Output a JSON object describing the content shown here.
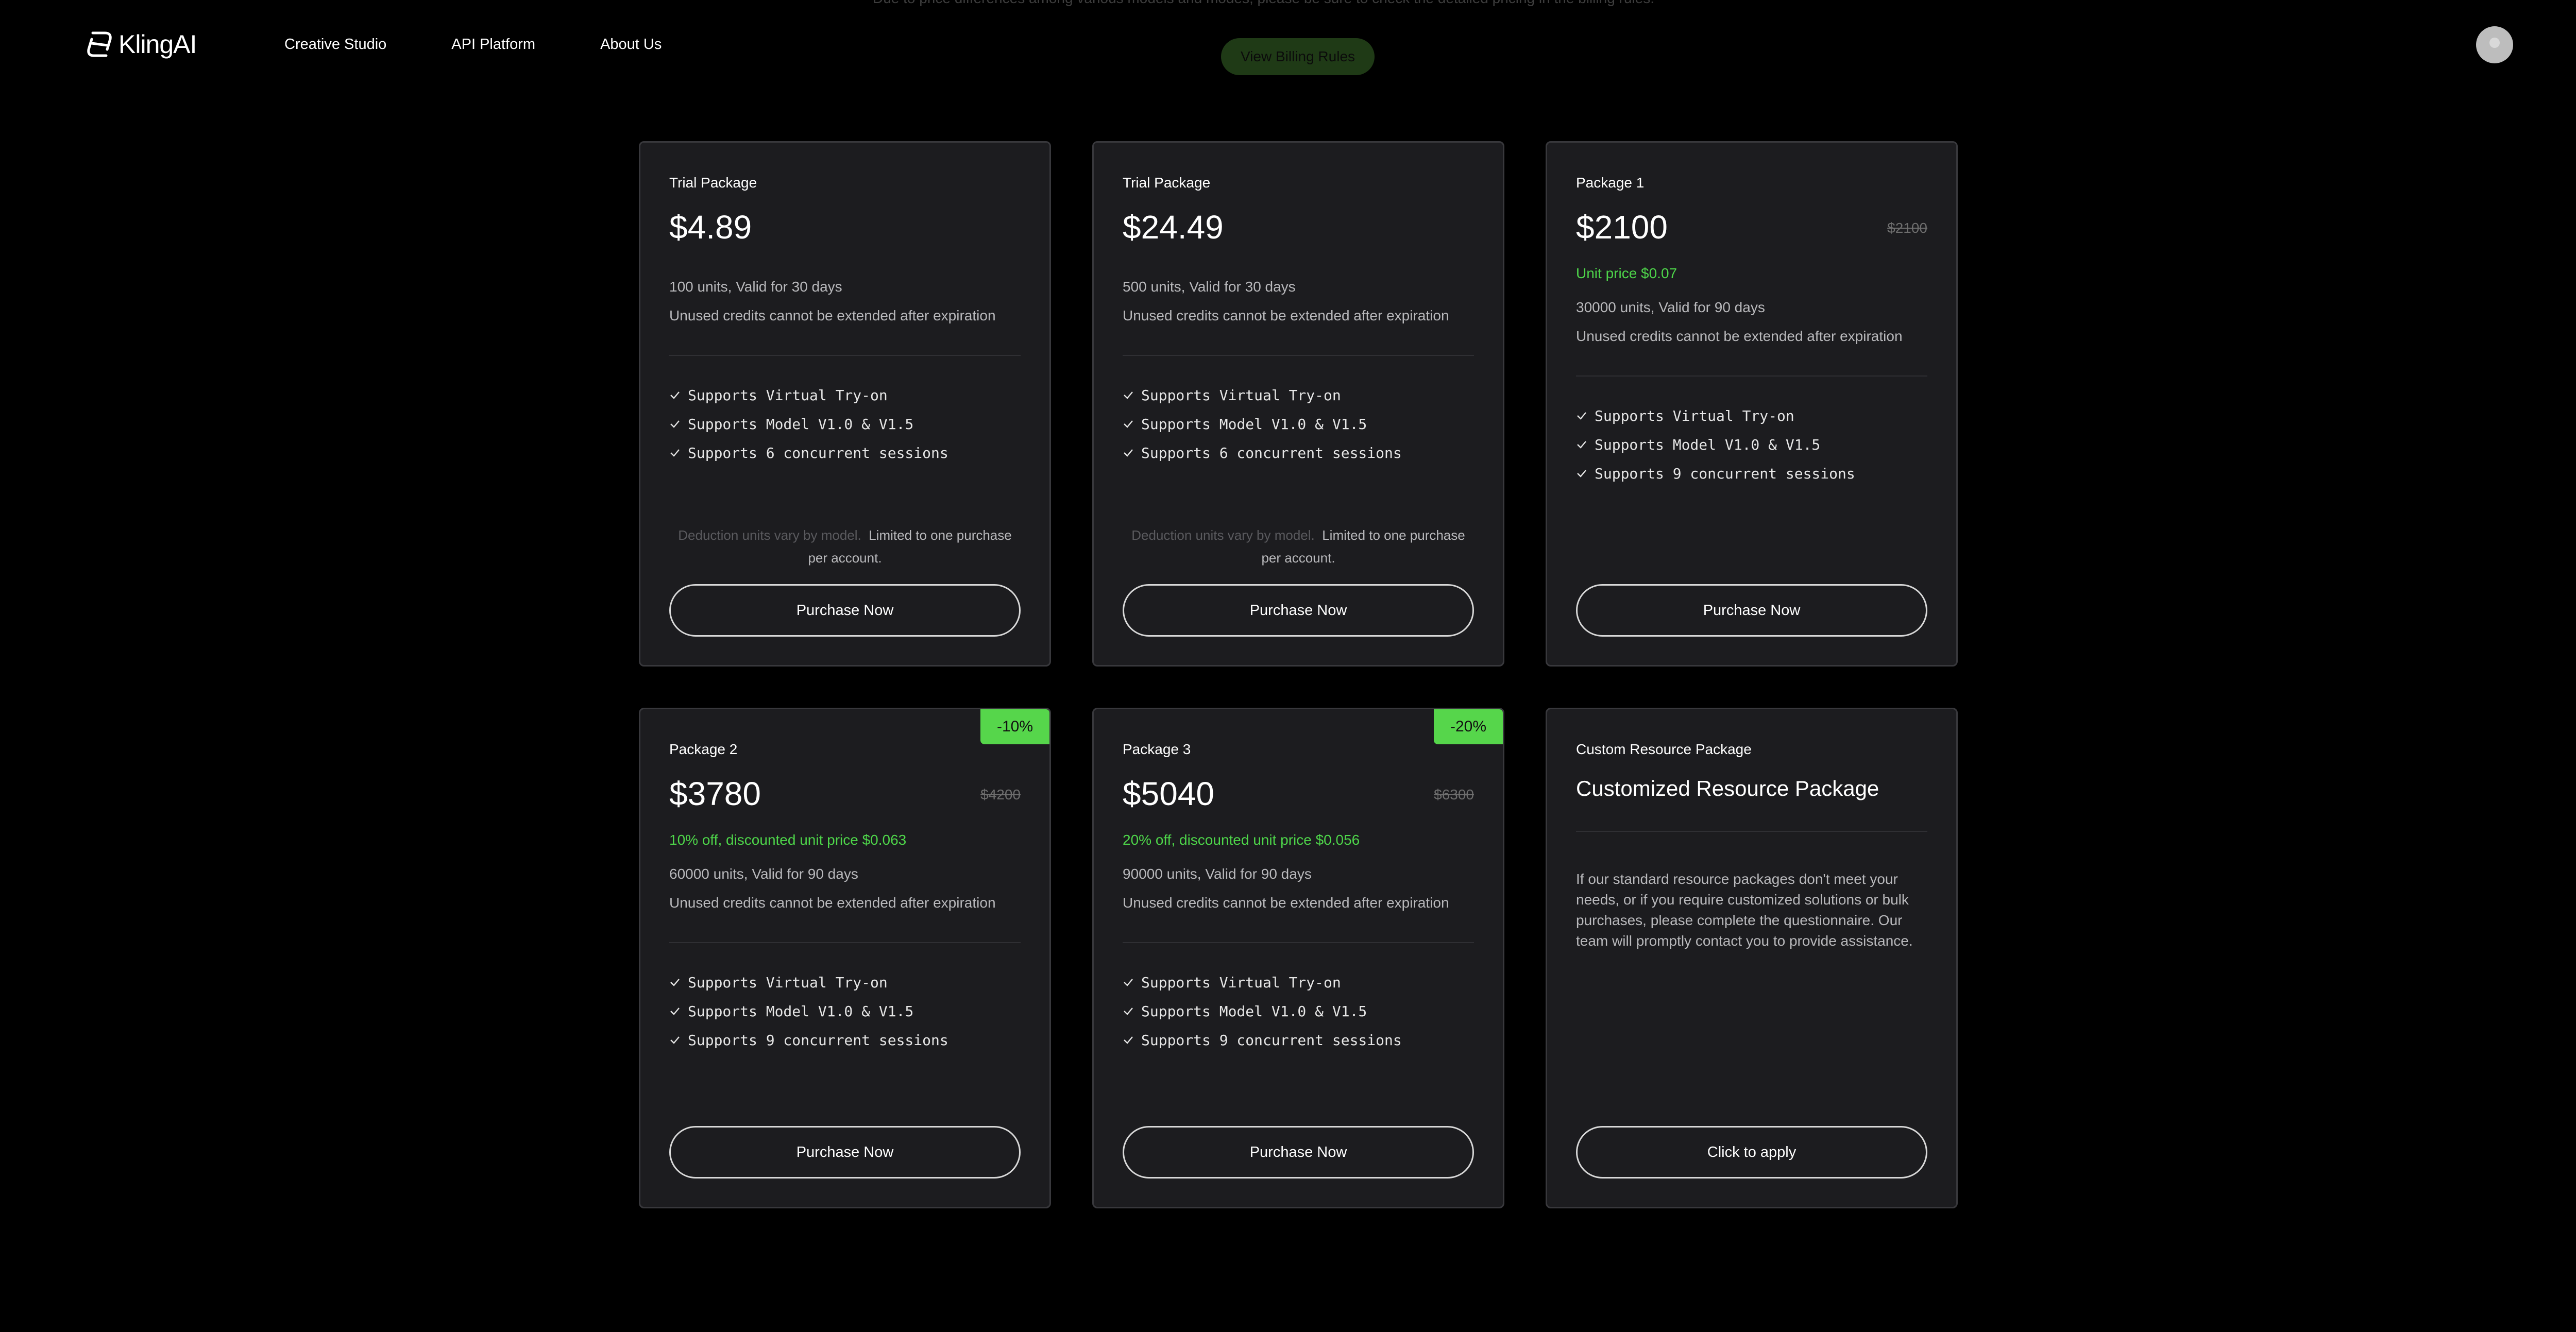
{
  "header": {
    "brand": "KlingAI",
    "nav": [
      {
        "label": "Creative Studio"
      },
      {
        "label": "API Platform"
      },
      {
        "label": "About Us"
      }
    ],
    "top_note": "Due to price differences among various models and modes, please be sure to check the detailed pricing in the billing rules.",
    "billing_button": "View Billing Rules"
  },
  "cards": [
    {
      "name": "Trial Package",
      "price": "$4.89",
      "units": "100 units, Valid for 30 days",
      "expiry": "Unused credits cannot be extended after expiration",
      "features": [
        "Supports Virtual Try-on",
        "Supports Model V1.0 & V1.5",
        "Supports 6 concurrent sessions"
      ],
      "note_muted": "Deduction units vary by model.",
      "note": "Limited to one purchase per account.",
      "button": "Purchase Now"
    },
    {
      "name": "Trial Package",
      "price": "$24.49",
      "units": "500 units, Valid for 30 days",
      "expiry": "Unused credits cannot be extended after expiration",
      "features": [
        "Supports Virtual Try-on",
        "Supports Model V1.0 & V1.5",
        "Supports 6 concurrent sessions"
      ],
      "note_muted": "Deduction units vary by model.",
      "note": "Limited to one purchase per account.",
      "button": "Purchase Now"
    },
    {
      "name": "Package 1",
      "price": "$2100",
      "old_price": "$2100",
      "unit_price": "Unit price $0.07",
      "units": "30000 units, Valid for 90 days",
      "expiry": "Unused credits cannot be extended after expiration",
      "features": [
        "Supports Virtual Try-on",
        "Supports Model V1.0 & V1.5",
        "Supports 9 concurrent sessions"
      ],
      "button": "Purchase Now"
    },
    {
      "name": "Package 2",
      "badge": "-10%",
      "price": "$3780",
      "old_price": "$4200",
      "unit_price": "10% off, discounted unit price $0.063",
      "units": "60000 units, Valid for 90 days",
      "expiry": "Unused credits cannot be extended after expiration",
      "features": [
        "Supports Virtual Try-on",
        "Supports Model V1.0 & V1.5",
        "Supports 9 concurrent sessions"
      ],
      "button": "Purchase Now"
    },
    {
      "name": "Package 3",
      "badge": "-20%",
      "price": "$5040",
      "old_price": "$6300",
      "unit_price": "20% off, discounted unit price $0.056",
      "units": "90000 units, Valid for 90 days",
      "expiry": "Unused credits cannot be extended after expiration",
      "features": [
        "Supports Virtual Try-on",
        "Supports Model V1.0 & V1.5",
        "Supports 9 concurrent sessions"
      ],
      "button": "Purchase Now"
    },
    {
      "name": "Custom Resource Package",
      "title": "Customized Resource Package",
      "description": "If our standard resource packages don't meet your needs, or if you require customized solutions or bulk purchases, please complete the questionnaire. Our team will promptly contact you to provide assistance.",
      "button": "Click to apply"
    }
  ],
  "colors": {
    "background": "#000000",
    "card": "#1c1c1f",
    "accent_green": "#56d64b",
    "price_green": "#4ed64a"
  },
  "icons": {
    "logo": "kling-logo-icon",
    "feature": "check-icon"
  }
}
